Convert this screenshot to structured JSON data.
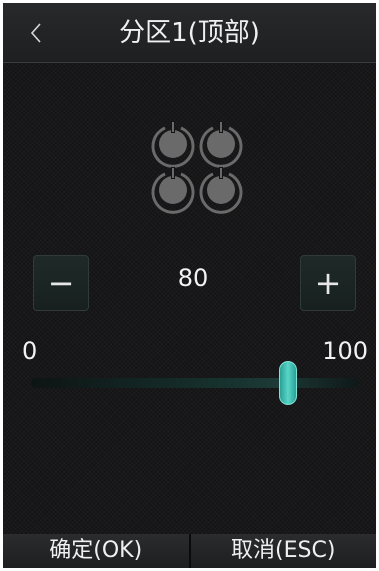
{
  "header": {
    "title": "分区1(顶部)",
    "back_icon": "chevron-left-icon"
  },
  "zone_icon": {
    "icon": "four-burners-icon"
  },
  "stepper": {
    "minus_label": "−",
    "plus_label": "+",
    "value": "80"
  },
  "slider": {
    "min_label": "0",
    "max_label": "100",
    "min": 0,
    "max": 100,
    "value": 80
  },
  "footer": {
    "confirm_label": "确定(OK)",
    "cancel_label": "取消(ESC)"
  },
  "colors": {
    "accent": "#4ecdc0",
    "background": "#141416"
  }
}
